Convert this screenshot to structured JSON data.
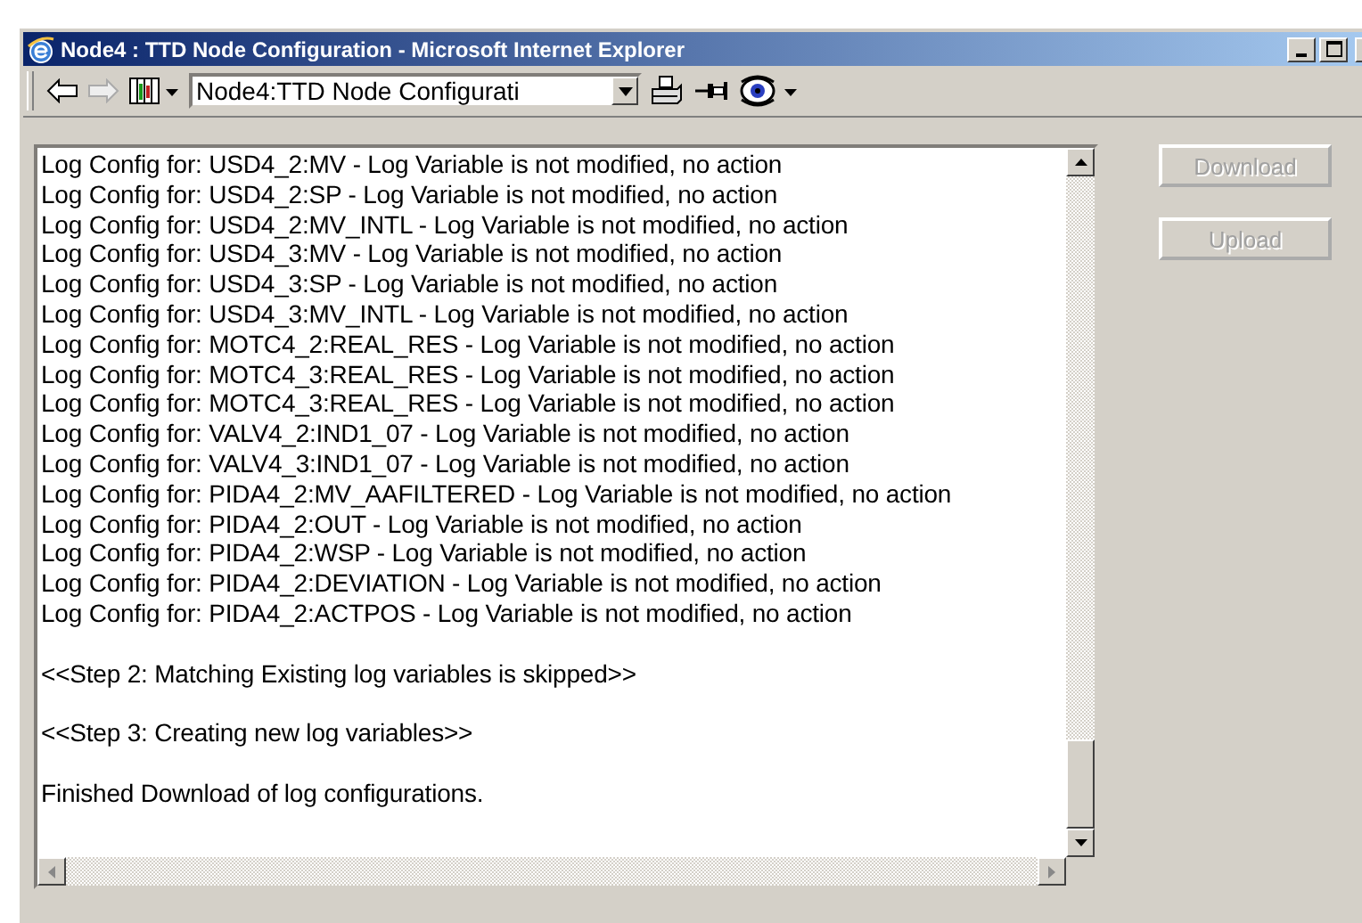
{
  "window": {
    "title": "Node4 : TTD Node Configuration - Microsoft Internet Explorer"
  },
  "toolbar": {
    "back_disabled": false,
    "forward_disabled": true,
    "address": "Node4:TTD Node Configurati"
  },
  "log": {
    "lines": [
      {
        "kind": "entry",
        "text": "Log Config for: USD4_2:MV - Log Variable is not modified, no action"
      },
      {
        "kind": "entry",
        "text": "Log Config for: USD4_2:SP - Log Variable is not modified, no action"
      },
      {
        "kind": "entry",
        "text": "Log Config for: USD4_2:MV_INTL - Log Variable is not modified, no action"
      },
      {
        "kind": "entry",
        "text": "Log Config for: USD4_3:MV - Log Variable is not modified, no action"
      },
      {
        "kind": "entry",
        "text": "Log Config for: USD4_3:SP - Log Variable is not modified, no action"
      },
      {
        "kind": "entry",
        "text": "Log Config for: USD4_3:MV_INTL - Log Variable is not modified, no action"
      },
      {
        "kind": "entry",
        "text": "Log Config for: MOTC4_2:REAL_RES - Log Variable is not modified, no action"
      },
      {
        "kind": "entry",
        "text": "Log Config for: MOTC4_3:REAL_RES - Log Variable is not modified, no action"
      },
      {
        "kind": "entry",
        "text": "Log Config for: MOTC4_3:REAL_RES - Log Variable is not modified, no action"
      },
      {
        "kind": "entry",
        "text": "Log Config for: VALV4_2:IND1_07 - Log Variable is not modified, no action"
      },
      {
        "kind": "entry",
        "text": "Log Config for: VALV4_3:IND1_07 - Log Variable is not modified, no action"
      },
      {
        "kind": "entry",
        "text": "Log Config for: PIDA4_2:MV_AAFILTERED - Log Variable is not modified, no action"
      },
      {
        "kind": "entry",
        "text": "Log Config for: PIDA4_2:OUT - Log Variable is not modified, no action"
      },
      {
        "kind": "entry",
        "text": "Log Config for: PIDA4_2:WSP - Log Variable is not modified, no action"
      },
      {
        "kind": "entry",
        "text": "Log Config for: PIDA4_2:DEVIATION - Log Variable is not modified, no action"
      },
      {
        "kind": "entry",
        "text": "Log Config for: PIDA4_2:ACTPOS - Log Variable is not modified, no action"
      },
      {
        "kind": "section",
        "text": "<<Step 2: Matching Existing log variables is skipped>>"
      },
      {
        "kind": "section",
        "text": "<<Step 3: Creating new log variables>>"
      },
      {
        "kind": "section",
        "text": "Finished Download of log configurations."
      }
    ]
  },
  "buttons": [
    {
      "label": "Download",
      "disabled": true
    },
    {
      "label": "Upload",
      "disabled": true
    }
  ]
}
